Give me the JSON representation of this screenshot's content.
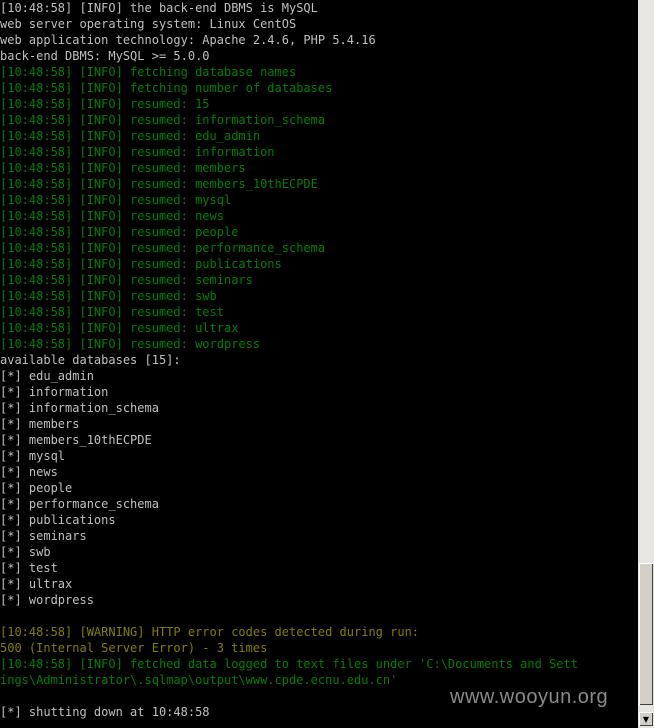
{
  "console": {
    "lines": [
      {
        "text": "[10:48:58] [INFO] the back-end DBMS is MySQL",
        "color": "white"
      },
      {
        "text": "web server operating system: Linux CentOS",
        "color": "white"
      },
      {
        "text": "web application technology: Apache 2.4.6, PHP 5.4.16",
        "color": "white"
      },
      {
        "text": "back-end DBMS: MySQL >= 5.0.0",
        "color": "white"
      },
      {
        "text": "[10:48:58] [INFO] fetching database names",
        "color": "green"
      },
      {
        "text": "[10:48:58] [INFO] fetching number of databases",
        "color": "green"
      },
      {
        "text": "[10:48:58] [INFO] resumed: 15",
        "color": "green"
      },
      {
        "text": "[10:48:58] [INFO] resumed: information_schema",
        "color": "green"
      },
      {
        "text": "[10:48:58] [INFO] resumed: edu_admin",
        "color": "green"
      },
      {
        "text": "[10:48:58] [INFO] resumed: information",
        "color": "green"
      },
      {
        "text": "[10:48:58] [INFO] resumed: members",
        "color": "green"
      },
      {
        "text": "[10:48:58] [INFO] resumed: members_10thECPDE",
        "color": "green"
      },
      {
        "text": "[10:48:58] [INFO] resumed: mysql",
        "color": "green"
      },
      {
        "text": "[10:48:58] [INFO] resumed: news",
        "color": "green"
      },
      {
        "text": "[10:48:58] [INFO] resumed: people",
        "color": "green"
      },
      {
        "text": "[10:48:58] [INFO] resumed: performance_schema",
        "color": "green"
      },
      {
        "text": "[10:48:58] [INFO] resumed: publications",
        "color": "green"
      },
      {
        "text": "[10:48:58] [INFO] resumed: seminars",
        "color": "green"
      },
      {
        "text": "[10:48:58] [INFO] resumed: swb",
        "color": "green"
      },
      {
        "text": "[10:48:58] [INFO] resumed: test",
        "color": "green"
      },
      {
        "text": "[10:48:58] [INFO] resumed: ultrax",
        "color": "green"
      },
      {
        "text": "[10:48:58] [INFO] resumed: wordpress",
        "color": "green"
      },
      {
        "text": "available databases [15]:",
        "color": "white"
      },
      {
        "text": "[*] edu_admin",
        "color": "white"
      },
      {
        "text": "[*] information",
        "color": "white"
      },
      {
        "text": "[*] information_schema",
        "color": "white"
      },
      {
        "text": "[*] members",
        "color": "white"
      },
      {
        "text": "[*] members_10thECPDE",
        "color": "white"
      },
      {
        "text": "[*] mysql",
        "color": "white"
      },
      {
        "text": "[*] news",
        "color": "white"
      },
      {
        "text": "[*] people",
        "color": "white"
      },
      {
        "text": "[*] performance_schema",
        "color": "white"
      },
      {
        "text": "[*] publications",
        "color": "white"
      },
      {
        "text": "[*] seminars",
        "color": "white"
      },
      {
        "text": "[*] swb",
        "color": "white"
      },
      {
        "text": "[*] test",
        "color": "white"
      },
      {
        "text": "[*] ultrax",
        "color": "white"
      },
      {
        "text": "[*] wordpress",
        "color": "white"
      },
      {
        "text": "",
        "color": "white"
      },
      {
        "text": "[10:48:58] [WARNING] HTTP error codes detected during run:",
        "color": "yellow"
      },
      {
        "text": "500 (Internal Server Error) - 3 times",
        "color": "yellow"
      },
      {
        "text": "[10:48:58] [INFO] fetched data logged to text files under 'C:\\Documents and Sett",
        "color": "green"
      },
      {
        "text": "ings\\Administrator\\.sqlmap\\output\\www.cpde.ecnu.edu.cn'",
        "color": "green"
      },
      {
        "text": "",
        "color": "white"
      },
      {
        "text": "[*] shutting down at 10:48:58",
        "color": "white"
      }
    ]
  },
  "watermark": "www.wooyun.org",
  "colors": {
    "white": "#c0c0c0",
    "green": "#008000",
    "yellow": "#808000",
    "background": "#000000"
  }
}
